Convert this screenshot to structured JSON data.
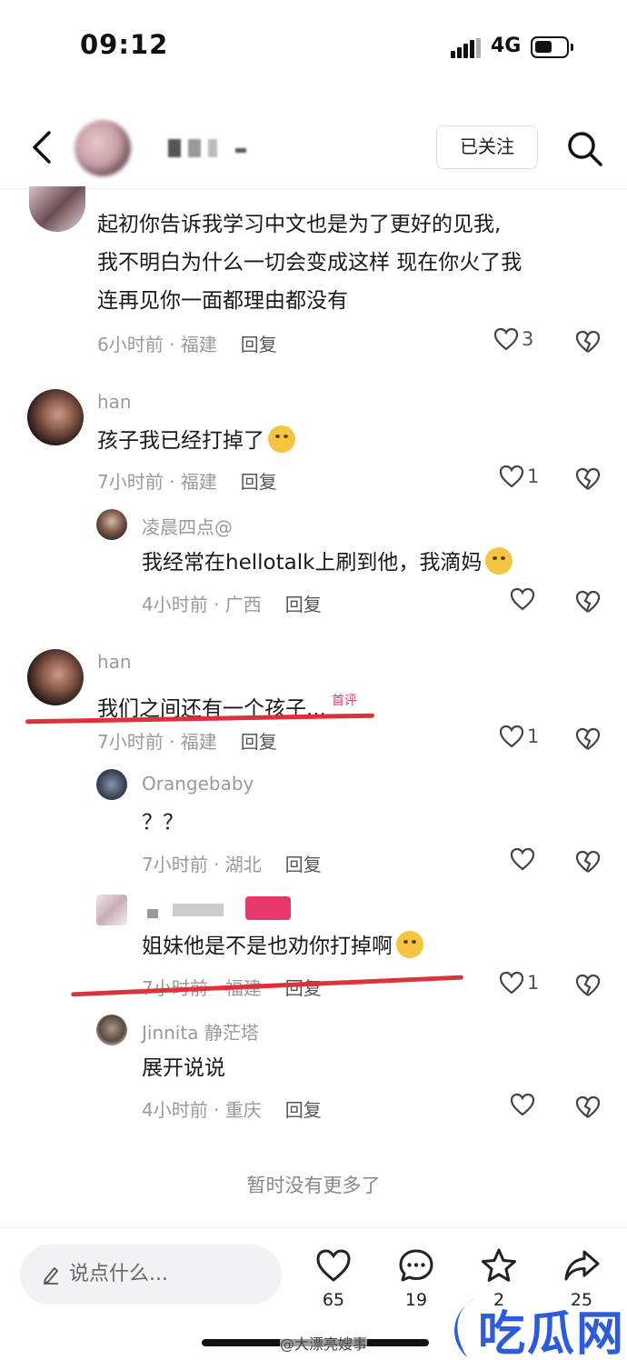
{
  "status": {
    "time": "09:12",
    "network": "4G"
  },
  "header": {
    "follow_label": "已关注"
  },
  "comments": [
    {
      "text_lines": [
        "起初你告诉我学习中文也是为了更好的见我,",
        "我不明白为什么一切会变成这样 现在你火了我",
        "连再见你一面都理由都没有"
      ],
      "time": "6小时前 · 福建",
      "reply": "回复",
      "likes": "3"
    },
    {
      "user": "han",
      "text": "孩子我已经打掉了",
      "time": "7小时前 · 福建",
      "reply": "回复",
      "likes": "1"
    },
    {
      "user": "凌晨四点@",
      "text": "我经常在hellotalk上刷到他，我滴妈",
      "time": "4小时前 · 广西",
      "reply": "回复",
      "likes": ""
    },
    {
      "user": "han",
      "text": "我们之间还有一个孩子...",
      "tag": "首评",
      "time": "7小时前 · 福建",
      "reply": "回复",
      "likes": "1"
    },
    {
      "user": "Orangebaby",
      "text": "？？",
      "time": "7小时前 · 湖北",
      "reply": "回复",
      "likes": ""
    },
    {
      "text": "姐妹他是不是也劝你打掉啊",
      "time": "7小时前 · 福建",
      "reply": "回复",
      "likes": "1"
    },
    {
      "user": "Jinnita 静茫塔",
      "text": "展开说说",
      "time": "4小时前 · 重庆",
      "reply": "回复",
      "likes": ""
    }
  ],
  "footer": {
    "no_more": "暂时没有更多了"
  },
  "bottom_bar": {
    "input_placeholder": "说点什么...",
    "likes": "65",
    "comments": "19",
    "favorites": "2",
    "shares": "25"
  },
  "watermark": {
    "text": "@大漂亮嫂事",
    "brand": "吃瓜网"
  },
  "colors": {
    "highlight_line": "#e0303a",
    "tag": "#e5396e",
    "brand_blue": "#2e5bd8"
  }
}
